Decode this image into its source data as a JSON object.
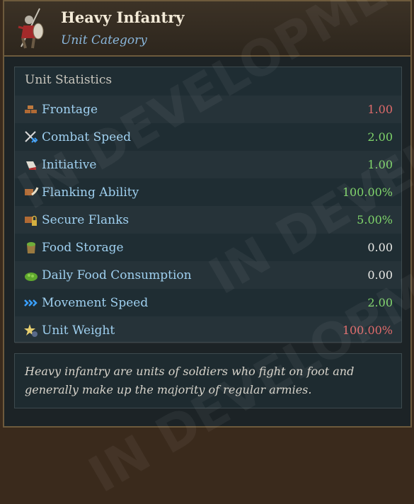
{
  "header": {
    "title": "Heavy Infantry",
    "subtitle": "Unit Category",
    "icon": "heavy-infantry-icon"
  },
  "stats": {
    "heading": "Unit Statistics",
    "rows": [
      {
        "label": "Frontage",
        "value": "1.00",
        "tone": "red",
        "icon": "frontage-icon"
      },
      {
        "label": "Combat Speed",
        "value": "2.00",
        "tone": "green",
        "icon": "combat-speed-icon"
      },
      {
        "label": "Initiative",
        "value": "1.00",
        "tone": "green",
        "icon": "initiative-icon"
      },
      {
        "label": "Flanking Ability",
        "value": "100.00%",
        "tone": "green",
        "icon": "flanking-ability-icon"
      },
      {
        "label": "Secure Flanks",
        "value": "5.00%",
        "tone": "green",
        "icon": "secure-flanks-icon"
      },
      {
        "label": "Food Storage",
        "value": "0.00",
        "tone": "white",
        "icon": "food-storage-icon"
      },
      {
        "label": "Daily Food Consumption",
        "value": "0.00",
        "tone": "white",
        "icon": "food-consumption-icon"
      },
      {
        "label": "Movement Speed",
        "value": "2.00",
        "tone": "green",
        "icon": "movement-speed-icon"
      },
      {
        "label": "Unit Weight",
        "value": "100.00%",
        "tone": "red",
        "icon": "unit-weight-icon"
      }
    ]
  },
  "description": "Heavy infantry are units of soldiers who fight on foot and generally make up the majority of regular armies.",
  "colors": {
    "label": "#9fd0f0",
    "positive": "#7fd46a",
    "negative": "#e06b6b",
    "neutral": "#e9e9e6",
    "subtitle": "#8ab7dc"
  }
}
